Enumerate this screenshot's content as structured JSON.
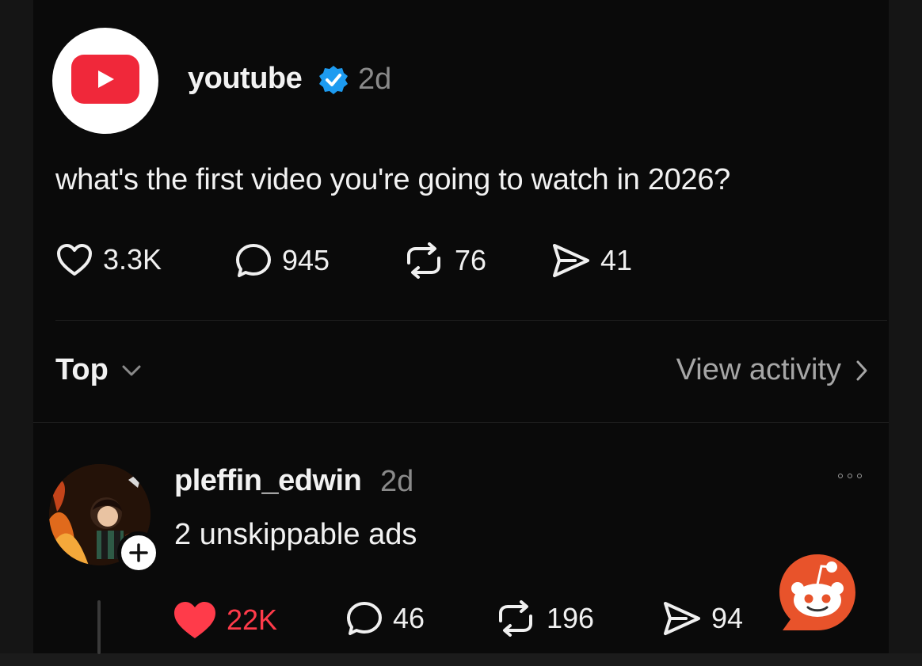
{
  "post": {
    "account": "youtube",
    "time": "2d",
    "text": "what's the first video you're going to watch in 2026?",
    "stats": {
      "likes": "3.3K",
      "replies": "945",
      "reposts": "76",
      "shares": "41"
    }
  },
  "sort": {
    "label": "Top",
    "view_activity": "View activity"
  },
  "reply": {
    "account": "pleffin_edwin",
    "time": "2d",
    "text": "2 unskippable ads",
    "stats": {
      "likes": "22K",
      "replies": "46",
      "reposts": "196",
      "shares": "94"
    },
    "liked": true
  },
  "colors": {
    "background": "#0a0a0a",
    "text": "#f2f2f2",
    "muted": "#8a8a8a",
    "like_red": "#ff3b4a",
    "verified_blue": "#1d9bf0",
    "youtube_red": "#f0283a",
    "reddit_orange": "#e8532b"
  },
  "icons": [
    "heart-icon",
    "comment-icon",
    "repost-icon",
    "share-icon",
    "verified-badge-icon",
    "chevron-down-icon",
    "chevron-right-icon",
    "more-icon",
    "plus-icon",
    "reddit-watermark-icon"
  ]
}
